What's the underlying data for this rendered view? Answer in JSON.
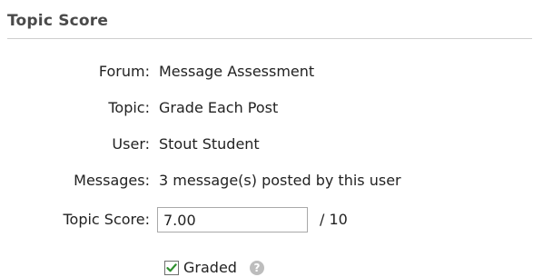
{
  "section": {
    "title": "Topic Score"
  },
  "fields": {
    "forum": {
      "label": "Forum:",
      "value": "Message Assessment"
    },
    "topic": {
      "label": "Topic:",
      "value": "Grade Each Post"
    },
    "user": {
      "label": "User:",
      "value": "Stout Student"
    },
    "messages": {
      "label": "Messages:",
      "value": "3 message(s) posted by this user"
    },
    "score": {
      "label": "Topic Score:",
      "value": "7.00",
      "max": "/ 10"
    }
  },
  "graded": {
    "label": "Graded",
    "checked": true
  },
  "icons": {
    "check": "checkmark-icon",
    "help": "help-icon"
  },
  "colors": {
    "checkmark": "#2f8f2f",
    "help_icon": "#bdbdbd"
  }
}
